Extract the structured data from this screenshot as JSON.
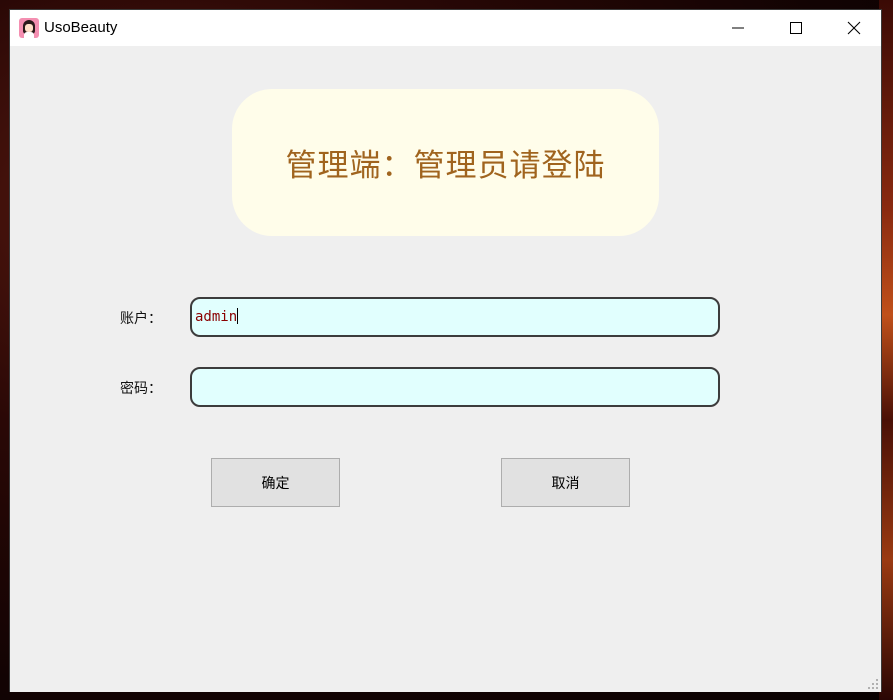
{
  "window": {
    "title": "UsoBeauty",
    "app_icon": "anime-girl-icon",
    "controls": [
      "minimize-icon",
      "maximize-icon",
      "close-icon"
    ]
  },
  "banner": {
    "text": "管理端：管理员请登陆"
  },
  "form": {
    "account_label": "账户：",
    "account_value": "admin",
    "password_label": "密码：",
    "password_value": ""
  },
  "buttons": {
    "ok_label": "确定",
    "cancel_label": "取消"
  },
  "colors": {
    "banner_bg": "#fffdea",
    "banner_text": "#a0641e",
    "input_bg": "#e1fffe",
    "input_text": "#8a0000",
    "window_bg": "#efefef"
  }
}
